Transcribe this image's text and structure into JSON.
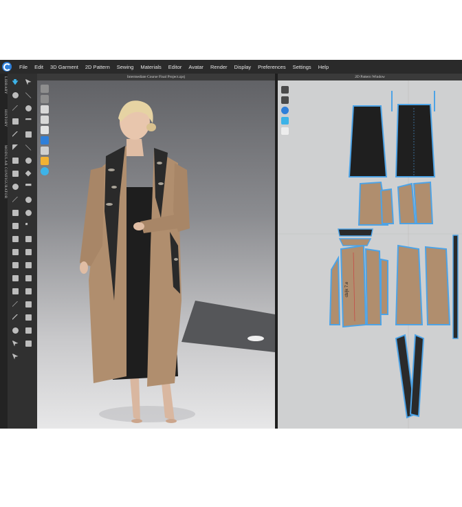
{
  "menu": [
    "File",
    "Edit",
    "3D Garment",
    "2D Pattern",
    "Sewing",
    "Materials",
    "Editor",
    "Avatar",
    "Render",
    "Display",
    "Preferences",
    "Settings",
    "Help"
  ],
  "side_tabs": [
    "LIBRARY",
    "HISTORY",
    "MODULAR CONFIGURATOR"
  ],
  "viewport": {
    "title": "Intermediate Course Final Project.zprj"
  },
  "pattern_window": {
    "title": "2D Pattern Window",
    "piece_label": "cb/jk 7.e"
  },
  "colors": {
    "coat": "#b08e6e",
    "dress": "#1e1e1e",
    "floral": "#2a2a2a",
    "pattern_outline": "#4da3e6",
    "selected_blue": "#2f7fd9"
  }
}
